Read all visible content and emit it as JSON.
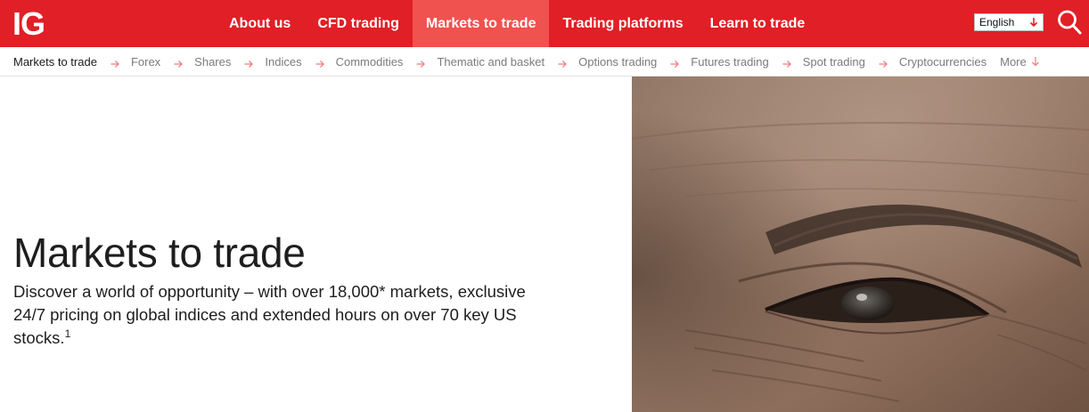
{
  "header": {
    "logo": "IG",
    "nav": [
      "About us",
      "CFD trading",
      "Markets to trade",
      "Trading platforms",
      "Learn to trade"
    ],
    "active_nav": "Markets to trade",
    "language": {
      "selected": "English"
    },
    "colors": {
      "brand_red": "#e01f26",
      "active_tab": "#f0524f"
    }
  },
  "subnav": {
    "current": "Markets to trade",
    "items": [
      "Forex",
      "Shares",
      "Indices",
      "Commodities",
      "Thematic and basket",
      "Options trading",
      "Futures trading",
      "Spot trading",
      "Cryptocurrencies"
    ],
    "more_label": "More"
  },
  "hero": {
    "title": "Markets to trade",
    "description": "Discover a world of opportunity – with over 18,000* markets, exclusive 24/7 pricing on global indices and extended hours on over 70 key US stocks.",
    "footnote_mark": "1"
  }
}
